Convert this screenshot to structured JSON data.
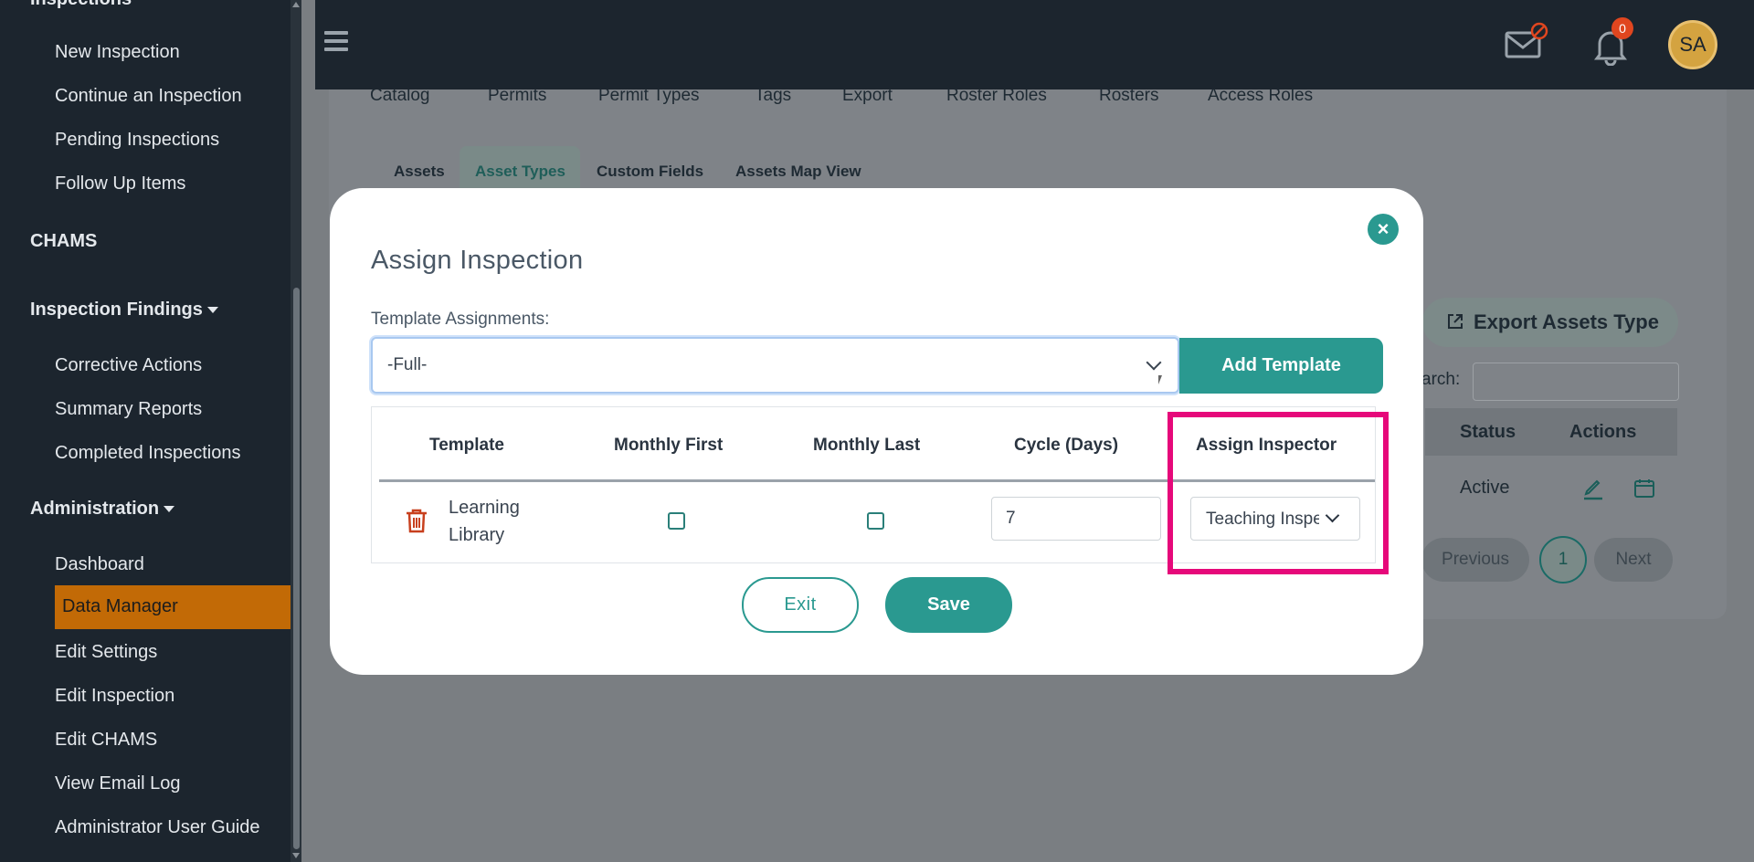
{
  "sidebar": {
    "top_cut_label": "Inspections",
    "items_group1": [
      "New Inspection",
      "Continue an Inspection",
      "Pending Inspections",
      "Follow Up Items"
    ],
    "chams": "CHAMS",
    "findings_head": "Inspection Findings",
    "items_group2": [
      "Corrective Actions",
      "Summary Reports",
      "Completed Inspections"
    ],
    "admin_head": "Administration",
    "items_group3": [
      "Dashboard",
      "Data Manager",
      "Edit Settings",
      "Edit Inspection",
      "Edit CHAMS",
      "View Email Log",
      "Administrator User Guide"
    ],
    "active_item": "Data Manager"
  },
  "topbar": {
    "notification_count": "0",
    "avatar_initials": "SA"
  },
  "page": {
    "tabs": [
      "Catalog",
      "Permits",
      "Permit Types",
      "Tags",
      "Export",
      "Roster Roles",
      "Rosters",
      "Access Roles"
    ],
    "subtabs": [
      "Assets",
      "Asset Types",
      "Custom Fields",
      "Assets Map View"
    ],
    "active_subtab": "Asset Types",
    "export_button": "Export Assets Type",
    "search_label": "arch:",
    "table_headers": [
      "Status",
      "Actions"
    ],
    "status_value": "Active",
    "pagination": {
      "previous": "Previous",
      "page": "1",
      "next": "Next"
    }
  },
  "modal": {
    "title": "Assign Inspection",
    "close_glyph": "×",
    "template_label": "Template Assignments:",
    "template_value": "-Full-",
    "add_template_button": "Add Template",
    "columns": [
      "Template",
      "Monthly First",
      "Monthly Last",
      "Cycle (Days)",
      "Assign Inspector"
    ],
    "row": {
      "template_line1": "Learning",
      "template_line2": "Library",
      "monthly_first": false,
      "monthly_last": false,
      "cycle_days": "7",
      "inspector": "Teaching Inspector"
    },
    "exit_button": "Exit",
    "save_button": "Save"
  },
  "colors": {
    "accent": "#2a9990",
    "highlight": "#e6087a",
    "sidebar_bg": "#1c252e",
    "active_item": "#c26a06"
  }
}
